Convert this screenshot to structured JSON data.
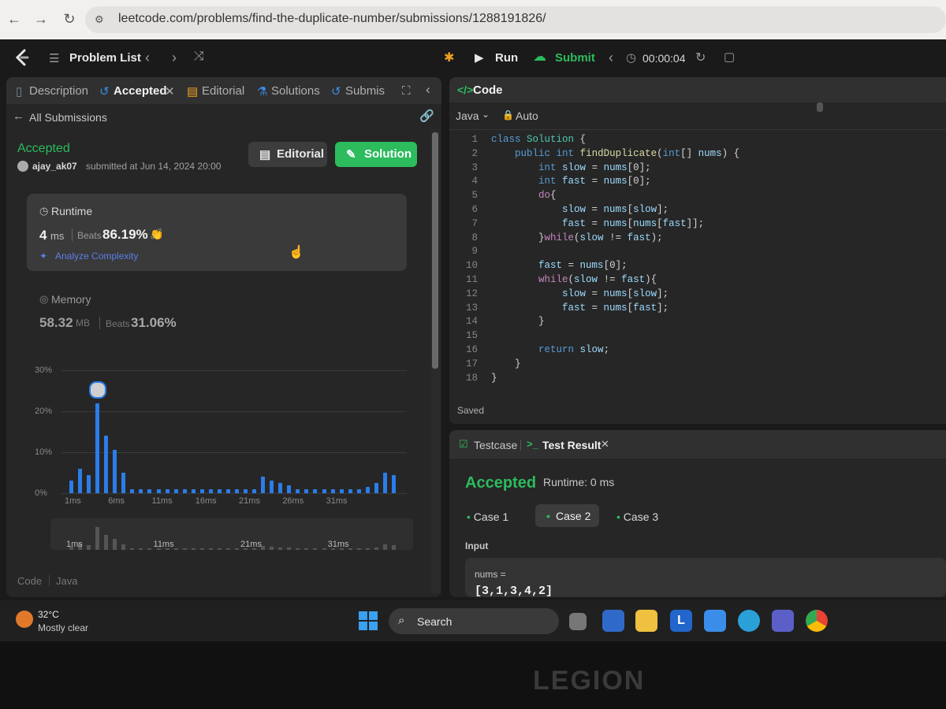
{
  "browser": {
    "url": "leetcode.com/problems/find-the-duplicate-number/submissions/1288191826/"
  },
  "topbar": {
    "problem_list": "Problem List",
    "run": "Run",
    "submit": "Submit",
    "timer": "00:00:04"
  },
  "left_tabs": {
    "description": "Description",
    "accepted": "Accepted",
    "editorial": "Editorial",
    "solutions": "Solutions",
    "submissions": "Submiss"
  },
  "submission": {
    "back_label": "All Submissions",
    "status": "Accepted",
    "user": "ajay_ak07",
    "submitted_text": "submitted at Jun 14, 2024 20:00",
    "editorial_btn": "Editorial",
    "solution_btn": "Solution",
    "runtime_label": "Runtime",
    "runtime_value": "4",
    "runtime_unit": "ms",
    "runtime_beats_label": "Beats",
    "runtime_beats": "86.19%",
    "analyze": "Analyze Complexity",
    "memory_label": "Memory",
    "memory_value": "58.32",
    "memory_unit": "MB",
    "memory_beats_label": "Beats",
    "memory_beats": "31.06%",
    "code_label": "Code",
    "code_lang": "Java"
  },
  "chart_data": {
    "type": "bar",
    "y_ticks": [
      "30%",
      "20%",
      "10%",
      "0%"
    ],
    "x_ticks": [
      "1ms",
      "6ms",
      "11ms",
      "16ms",
      "21ms",
      "26ms",
      "31ms"
    ],
    "mini_x_ticks": [
      "1ms",
      "11ms",
      "21ms",
      "31ms"
    ],
    "ylim": [
      0,
      30
    ],
    "values": [
      3,
      6,
      4.5,
      22,
      14,
      10.5,
      5,
      1,
      1,
      1,
      1,
      1,
      1,
      1,
      1,
      1,
      1,
      1,
      1,
      1,
      1,
      1,
      4,
      3,
      2.5,
      2,
      1,
      1,
      1,
      1,
      1,
      1,
      1,
      1,
      1.5,
      2.5,
      5,
      4.5
    ],
    "highlight_index": 3
  },
  "code_panel": {
    "title": "Code",
    "lang": "Java",
    "mode": "Auto",
    "saved": "Saved",
    "lines": [
      "class Solution {",
      "    public int findDuplicate(int[] nums) {",
      "        int slow = nums[0];",
      "        int fast = nums[0];",
      "        do{",
      "            slow = nums[slow];",
      "            fast = nums[nums[fast]];",
      "        }while(slow != fast);",
      "",
      "        fast = nums[0];",
      "        while(slow != fast){",
      "            slow = nums[slow];",
      "            fast = nums[fast];",
      "        }",
      "",
      "        return slow;",
      "    }",
      "}"
    ]
  },
  "test_panel": {
    "testcase_tab": "Testcase",
    "result_tab": "Test Result",
    "status": "Accepted",
    "runtime": "Runtime: 0 ms",
    "cases": [
      "Case 1",
      "Case 2",
      "Case 3"
    ],
    "input_label": "Input",
    "input_var": "nums =",
    "input_value": "[3,1,3,4,2]"
  },
  "taskbar": {
    "temp": "32°C",
    "weather": "Mostly clear",
    "search": "Search"
  },
  "bezel": {
    "brand": "LEGION"
  }
}
